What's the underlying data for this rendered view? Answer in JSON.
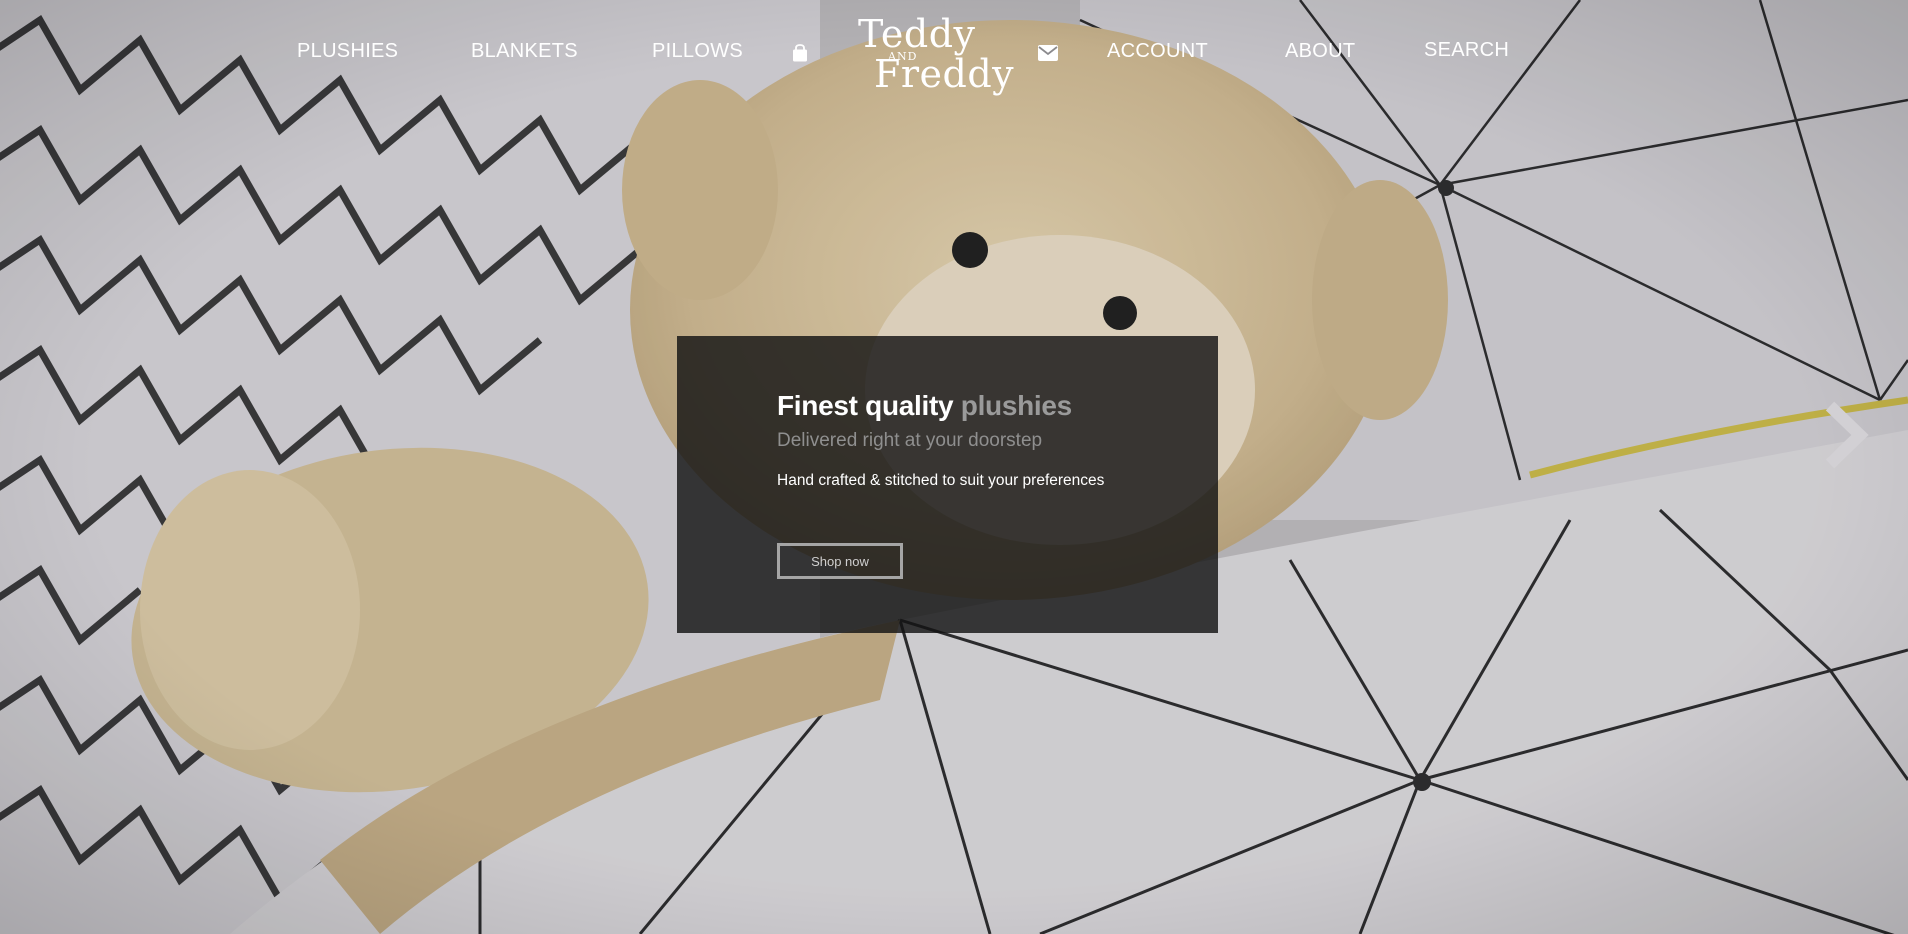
{
  "nav": {
    "left_items": [
      {
        "label": "PLUSHIES"
      },
      {
        "label": "BLANKETS"
      },
      {
        "label": "PILLOWS"
      }
    ],
    "right_items": [
      {
        "label": "ACCOUNT"
      },
      {
        "label": "ABOUT"
      },
      {
        "label": "SEARCH"
      }
    ],
    "cart_icon": "shopping-bag-icon",
    "mail_icon": "envelope-icon"
  },
  "logo": {
    "line1": "Teddy",
    "line2": "AND",
    "line3": "Freddy"
  },
  "hero": {
    "title_main": "Finest quality",
    "title_accent": "plushies",
    "subtitle": "Delivered right at your doorstep",
    "description": "Hand crafted & stitched to suit your preferences",
    "cta_label": "Shop now",
    "next_icon": "chevron-right-icon"
  },
  "colors": {
    "nav_text": "#ffffff",
    "caption_bg": "#141414",
    "muted_text": "#9a9a9a",
    "bedding": "#d6d4d8",
    "bear": "#d9c6a0"
  }
}
